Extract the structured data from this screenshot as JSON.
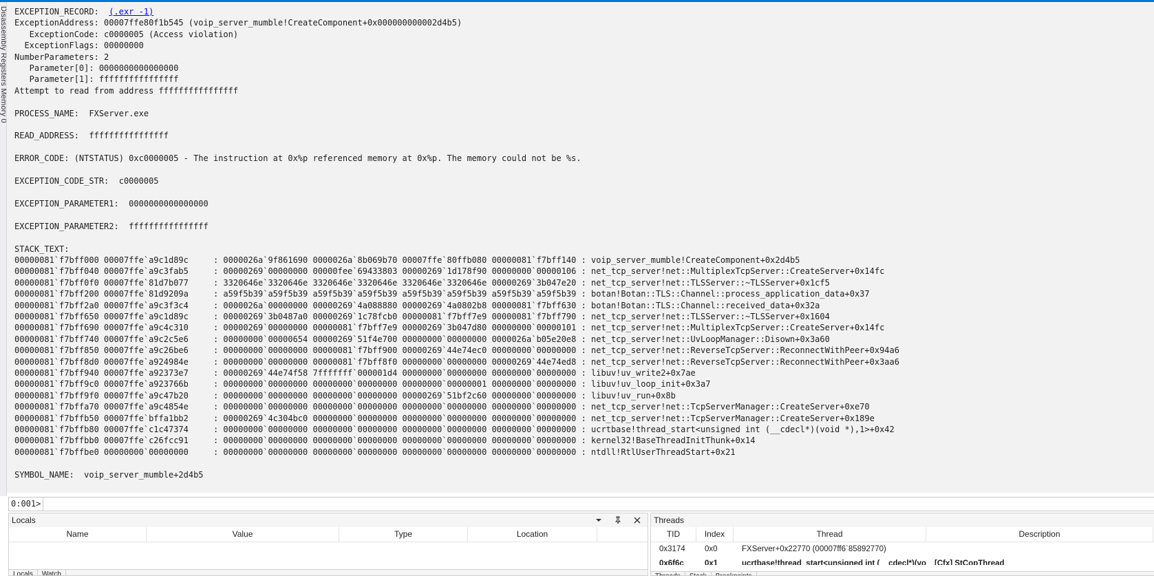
{
  "left_strip": {
    "label": "Disassembly  Registers  Memory 0"
  },
  "output": {
    "exr_label": "EXCEPTION_RECORD:  ",
    "exr_link": "(.exr -1)",
    "lines_before_stack": [
      "ExceptionAddress: 00007ffe80f1b545 (voip_server_mumble!CreateComponent+0x000000000002d4b5)",
      "   ExceptionCode: c0000005 (Access violation)",
      "  ExceptionFlags: 00000000",
      "NumberParameters: 2",
      "   Parameter[0]: 0000000000000000",
      "   Parameter[1]: ffffffffffffffff",
      "Attempt to read from address ffffffffffffffff",
      "",
      "PROCESS_NAME:  FXServer.exe",
      "",
      "READ_ADDRESS:  ffffffffffffffff",
      "",
      "ERROR_CODE: (NTSTATUS) 0xc0000005 - The instruction at 0x%p referenced memory at 0x%p. The memory could not be %s.",
      "",
      "EXCEPTION_CODE_STR:  c0000005",
      "",
      "EXCEPTION_PARAMETER1:  0000000000000000",
      "",
      "EXCEPTION_PARAMETER2:  ffffffffffffffff",
      "",
      "STACK_TEXT:"
    ],
    "stack_text": [
      "00000081`f7bff000 00007ffe`a9c1d89c     : 0000026a`9f861690 0000026a`8b069b70 00007ffe`80ffb080 00000081`f7bff140 : voip_server_mumble!CreateComponent+0x2d4b5",
      "00000081`f7bff040 00007ffe`a9c3fab5     : 00000269`00000000 00000fee`69433803 00000269`1d178f90 00000000`00000106 : net_tcp_server!net::MultiplexTcpServer::CreateServer+0x14fc",
      "00000081`f7bff0f0 00007ffe`81d7b077     : 3320646e`3320646e 3320646e`3320646e 3320646e`3320646e 00000269`3b047e20 : net_tcp_server!net::TLSServer::~TLSServer+0x1cf5",
      "00000081`f7bff200 00007ffe`81d9209a     : a59f5b39`a59f5b39 a59f5b39`a59f5b39 a59f5b39`a59f5b39 a59f5b39`a59f5b39 : botan!Botan::TLS::Channel::process_application_data+0x37",
      "00000081`f7bff2a0 00007ffe`a9c3f3c4     : 0000026a`00000000 00000269`4a088880 00000269`4a0802b8 00000081`f7bff630 : botan!Botan::TLS::Channel::received_data+0x32a",
      "00000081`f7bff650 00007ffe`a9c1d89c     : 00000269`3b0487a0 00000269`1c78fcb0 00000081`f7bff7e9 00000081`f7bff790 : net_tcp_server!net::TLSServer::~TLSServer+0x1604",
      "00000081`f7bff690 00007ffe`a9c4c310     : 00000269`00000000 00000081`f7bff7e9 00000269`3b047d80 00000000`00000101 : net_tcp_server!net::MultiplexTcpServer::CreateServer+0x14fc",
      "00000081`f7bff740 00007ffe`a9c2c5e6     : 00000000`00000654 00000269`51f4e700 00000000`00000000 0000026a`b05e20e8 : net_tcp_server!net::UvLoopManager::Disown+0x3a60",
      "00000081`f7bff850 00007ffe`a9c26be6     : 00000000`00000000 00000081`f7bff900 00000269`44e74ec0 00000000`00000000 : net_tcp_server!net::ReverseTcpServer::ReconnectWithPeer+0x94a6",
      "00000081`f7bff8d0 00007ffe`a924984e     : 00000000`00000000 00000081`f7bff8f0 00000000`00000000 00000269`44e74ed8 : net_tcp_server!net::ReverseTcpServer::ReconnectWithPeer+0x3aa6",
      "00000081`f7bff940 00007ffe`a92373e7     : 00000269`44e74f58 7fffffff`000001d4 00000000`00000000 00000000`00000000 : libuv!uv_write2+0x7ae",
      "00000081`f7bff9c0 00007ffe`a923766b     : 00000000`00000000 00000000`00000000 00000000`00000001 00000000`00000000 : libuv!uv_loop_init+0x3a7",
      "00000081`f7bff9f0 00007ffe`a9c47b20     : 00000000`00000000 00000000`00000000 00000269`51bf2c60 00000000`00000000 : libuv!uv_run+0x8b",
      "00000081`f7bffa70 00007ffe`a9c4854e     : 00000000`00000000 00000000`00000000 00000000`00000000 00000000`00000000 : net_tcp_server!net::TcpServerManager::CreateServer+0xe70",
      "00000081`f7bffb50 00007ffe`bffa1bb2     : 00000269`4c304bc0 00000000`00000000 00000000`00000000 00000000`00000000 : net_tcp_server!net::TcpServerManager::CreateServer+0x189e",
      "00000081`f7bffb80 00007ffe`c1c47374     : 00000000`00000000 00000000`00000000 00000000`00000000 00000000`00000000 : ucrtbase!thread_start<unsigned int (__cdecl*)(void *),1>+0x42",
      "00000081`f7bffbb0 00007ffe`c26fcc91     : 00000000`00000000 00000000`00000000 00000000`00000000 00000000`00000000 : kernel32!BaseThreadInitThunk+0x14",
      "00000081`f7bffbe0 00000000`00000000     : 00000000`00000000 00000000`00000000 00000000`00000000 00000000`00000000 : ntdll!RtlUserThreadStart+0x21"
    ],
    "symbol_name": "SYMBOL_NAME:  voip_server_mumble+2d4b5"
  },
  "command": {
    "prompt": "0:001>",
    "value": ""
  },
  "locals": {
    "title": "Locals",
    "columns": [
      "Name",
      "Value",
      "Type",
      "Location"
    ],
    "tabs": [
      "Locals",
      "Watch"
    ]
  },
  "threads": {
    "title": "Threads",
    "columns": [
      "TID",
      "Index",
      "Thread",
      "Description"
    ],
    "rows": [
      {
        "tid": "0x3174",
        "index": "0x0",
        "thread": "FXServer+0x22770 (00007ff6`85892770)",
        "description": ""
      },
      {
        "tid": "0x6f6c",
        "index": "0x1",
        "thread": "ucrtbase!thread_start<unsigned int (__cdecl*)(vo...",
        "description": "[Cfx] StCopThread"
      }
    ],
    "tabs": [
      "Threads",
      "Stack",
      "Breakpoints"
    ]
  }
}
